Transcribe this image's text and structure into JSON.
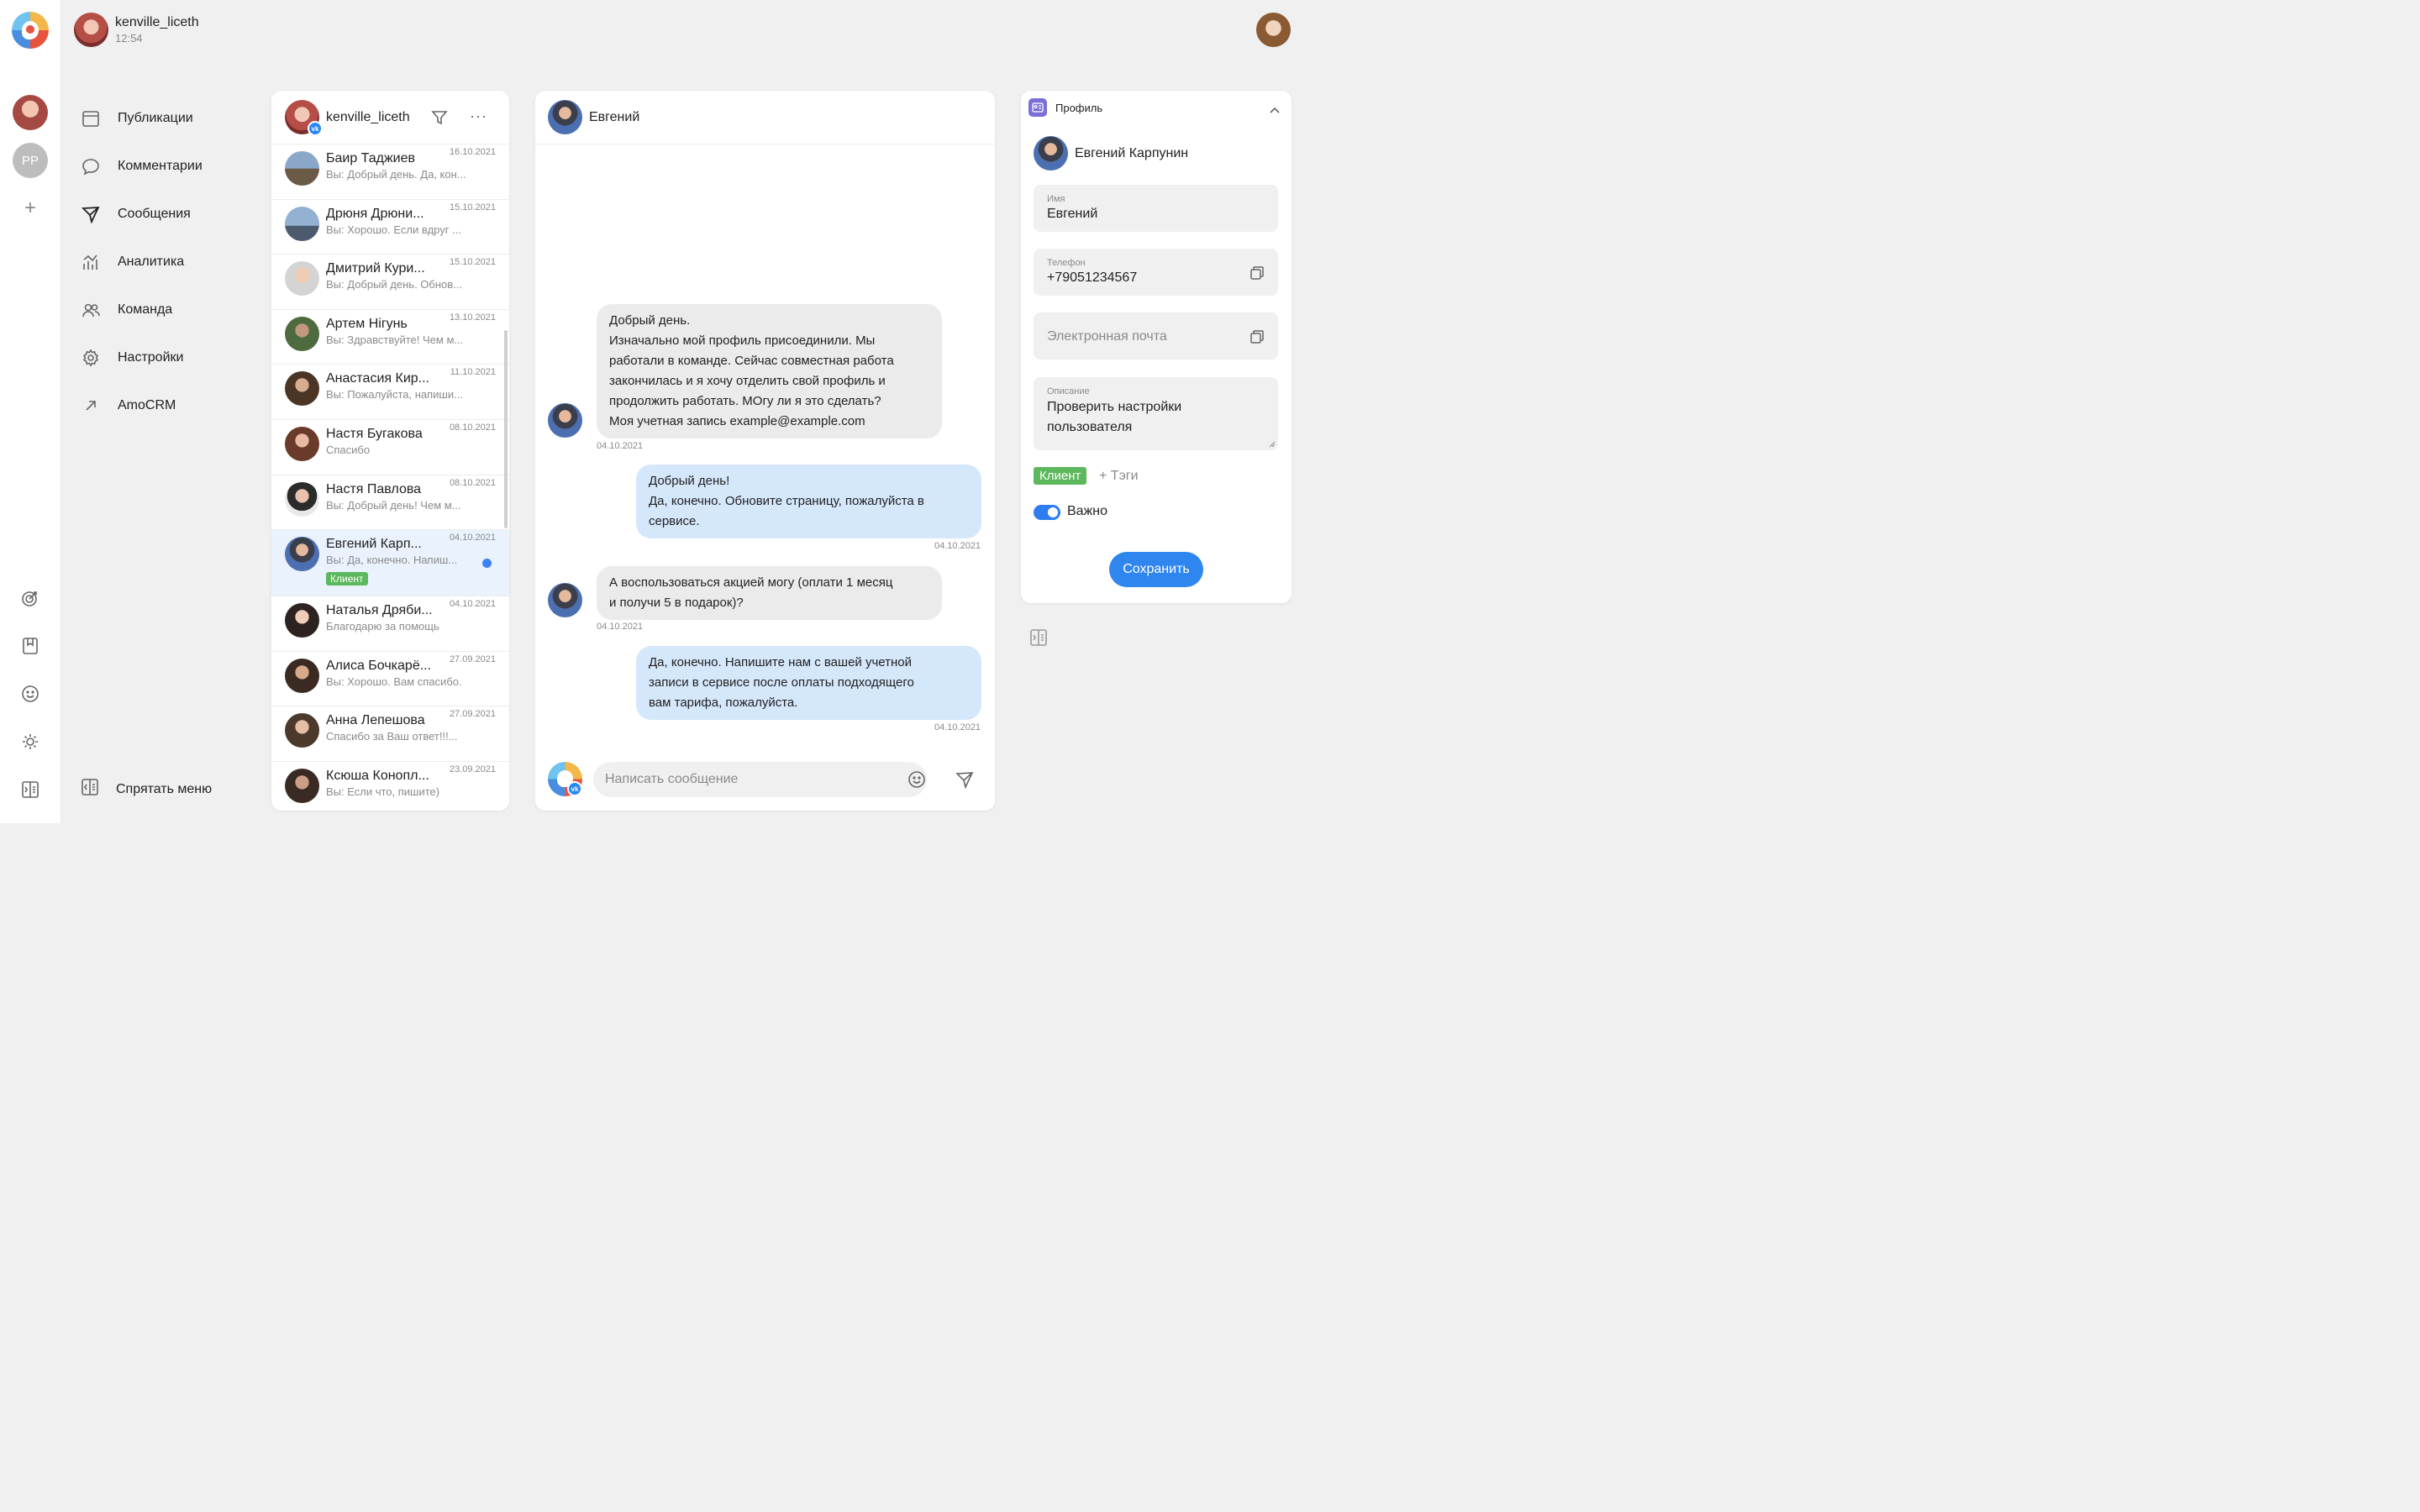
{
  "top": {
    "username": "kenville_liceth",
    "time": "12:54"
  },
  "rail": {
    "account2_initials": "PP"
  },
  "nav": {
    "items": [
      {
        "label": "Публикации",
        "icon": "calendar-icon"
      },
      {
        "label": "Комментарии",
        "icon": "comment-bubble-icon"
      },
      {
        "label": "Сообщения",
        "icon": "paper-plane-icon"
      },
      {
        "label": "Аналитика",
        "icon": "analytics-icon"
      },
      {
        "label": "Команда",
        "icon": "team-icon"
      },
      {
        "label": "Настройки",
        "icon": "gear-icon"
      },
      {
        "label": "AmoCRM",
        "icon": "arrow-up-right-icon"
      }
    ],
    "hide_label": "Спрятать меню"
  },
  "list": {
    "account_name": "kenville_liceth",
    "conversations": [
      {
        "name": "Баир Таджиев",
        "preview": "Вы: Добрый день. Да, кон...",
        "date": "16.10.2021"
      },
      {
        "name": "Дрюня Дрюни...",
        "preview": "Вы: Хорошо. Если вдруг ...",
        "date": "15.10.2021"
      },
      {
        "name": "Дмитрий Кури...",
        "preview": "Вы: Добрый день. Обнов...",
        "date": "15.10.2021"
      },
      {
        "name": "Артем Нігунь",
        "preview": "Вы: Здравствуйте! Чем м...",
        "date": "13.10.2021"
      },
      {
        "name": "Анастасия Кир...",
        "preview": "Вы: Пожалуйста, напиши...",
        "date": "11.10.2021"
      },
      {
        "name": "Настя Бугакова",
        "preview": "Спасибо",
        "date": "08.10.2021"
      },
      {
        "name": "Настя Павлова",
        "preview": "Вы: Добрый день! Чем м...",
        "date": "08.10.2021"
      },
      {
        "name": "Евгений Карп...",
        "preview": "Вы: Да, конечно. Напиш...",
        "date": "04.10.2021",
        "tag": "Клиент"
      },
      {
        "name": "Наталья Дряби...",
        "preview": "Благодарю за помощь",
        "date": "04.10.2021"
      },
      {
        "name": "Алиса Бочкарё...",
        "preview": "Вы: Хорошо. Вам спасибо.",
        "date": "27.09.2021"
      },
      {
        "name": "Анна Лепешова",
        "preview": "Спасибо за Ваш ответ!!!...",
        "date": "27.09.2021"
      },
      {
        "name": "Ксюша Конопл...",
        "preview": "Вы: Если что, пишите)",
        "date": "23.09.2021"
      }
    ]
  },
  "chat": {
    "contact_name": "Евгений",
    "messages": [
      {
        "dir": "in",
        "lines": [
          "Добрый день.",
          "Изначально мой профиль присоединили. Мы",
          "работали в команде. Сейчас совместная работа",
          "закончилась и я хочу отделить свой профиль и",
          "продолжить работать. МОгу ли я это сделать?",
          "Моя учетная запись example@example.com"
        ],
        "date": "04.10.2021"
      },
      {
        "dir": "out",
        "lines": [
          "Добрый день!",
          "Да, конечно. Обновите страницу, пожалуйста в",
          "сервисе."
        ],
        "date": "04.10.2021"
      },
      {
        "dir": "in",
        "lines": [
          "А воспользоваться акцией могу (оплати 1 месяц",
          "и получи 5 в подарок)?"
        ],
        "date": "04.10.2021"
      },
      {
        "dir": "out",
        "lines": [
          "Да, конечно. Напишите нам с вашей учетной",
          "записи в сервисе после оплаты подходящего",
          "вам тарифа, пожалуйста."
        ],
        "date": "04.10.2021"
      }
    ],
    "input_placeholder": "Написать сообщение"
  },
  "profile": {
    "title": "Профиль",
    "full_name": "Евгений Карпунин",
    "name_label": "Имя",
    "name_value": "Евгений",
    "phone_label": "Телефон",
    "phone_value": "+79051234567",
    "email_placeholder": "Электронная почта",
    "desc_label": "Описание",
    "desc_lines": [
      "Проверить настройки",
      "пользователя"
    ],
    "tag": "Клиент",
    "add_tags": "+ Тэги",
    "important_label": "Важно",
    "important_on": true,
    "save_label": "Сохранить"
  },
  "colors": {
    "accent": "#2e86ee",
    "tag_green": "#5cb85c",
    "bubble_out": "#d4e7fb",
    "bubble_in": "#ebebeb",
    "active_row": "#e9f2fd"
  }
}
